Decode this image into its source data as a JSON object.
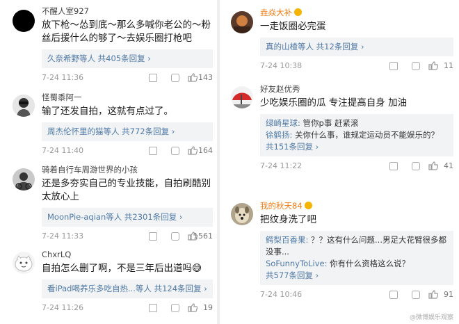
{
  "left": [
    {
      "username": "不醒人室927",
      "text": "放下枪～怂到底～那么多喊你老公的～粉丝后援什么的够了～去娱乐圈打枪吧",
      "replies": [],
      "summary_a": "久奈希野等人",
      "summary_b": "共405条回复",
      "time": "7-24 11:36",
      "likes": "143"
    },
    {
      "username": "怪蜀黍阿一",
      "text": "输了还发自拍，这就有点过了。",
      "replies": [],
      "summary_a": "周杰伦怀里的猫等人",
      "summary_b": "共772条回复",
      "time": "7-24 11:40",
      "likes": "164"
    },
    {
      "username": "骑着自行车周游世界的小孩",
      "text": "还是多夯实自己的专业技能，自拍刷酷别太放心上",
      "replies": [],
      "summary_a": "MoonPie-aqian等人",
      "summary_b": "共2301条回复",
      "time": "7-24 11:33",
      "likes": "1561"
    },
    {
      "username": "ChxrLQ",
      "text": "自拍怎么删了啊，不是三年后出道吗😅",
      "replies": [],
      "summary_a": "看iPad喝养乐多吃自热...等人",
      "summary_b": "共124条回复",
      "time": "7-24 11:26",
      "likes": "19"
    }
  ],
  "right": [
    {
      "username": "垚焱大补",
      "text": "一走饭圈必完蛋",
      "replies": [],
      "summary_a": "真的山楂等人",
      "summary_b": "共12条回复",
      "time": "7-24 10:38",
      "likes": "11"
    },
    {
      "username": "好友赵优秀",
      "text": "少吃娱乐圈的瓜 专注提高自身 加油",
      "replies": [
        {
          "user": "绿崎星球:",
          "text": " 管你p事 赶紧滚"
        },
        {
          "user": "徐鹤扬:",
          "text": " 关你什么事，谁规定运动员不能娱乐的？"
        }
      ],
      "summary_a": "",
      "summary_b": "共151条回复",
      "time": "7-24 11:22",
      "likes": "41"
    },
    {
      "username": "我的秋天84",
      "text": "把纹身洗了吧",
      "replies": [
        {
          "user": "鳄梨百香果:",
          "text": " ？？这有什么问题...男足大花臂很多都没事..."
        },
        {
          "user": "SoFunnyToLive:",
          "text": " 你有什么资格这么说？"
        }
      ],
      "summary_a": "",
      "summary_b": "共577条回复",
      "time": "7-24 10:46",
      "likes": "91"
    }
  ],
  "watermark": "@微博娱乐观察"
}
